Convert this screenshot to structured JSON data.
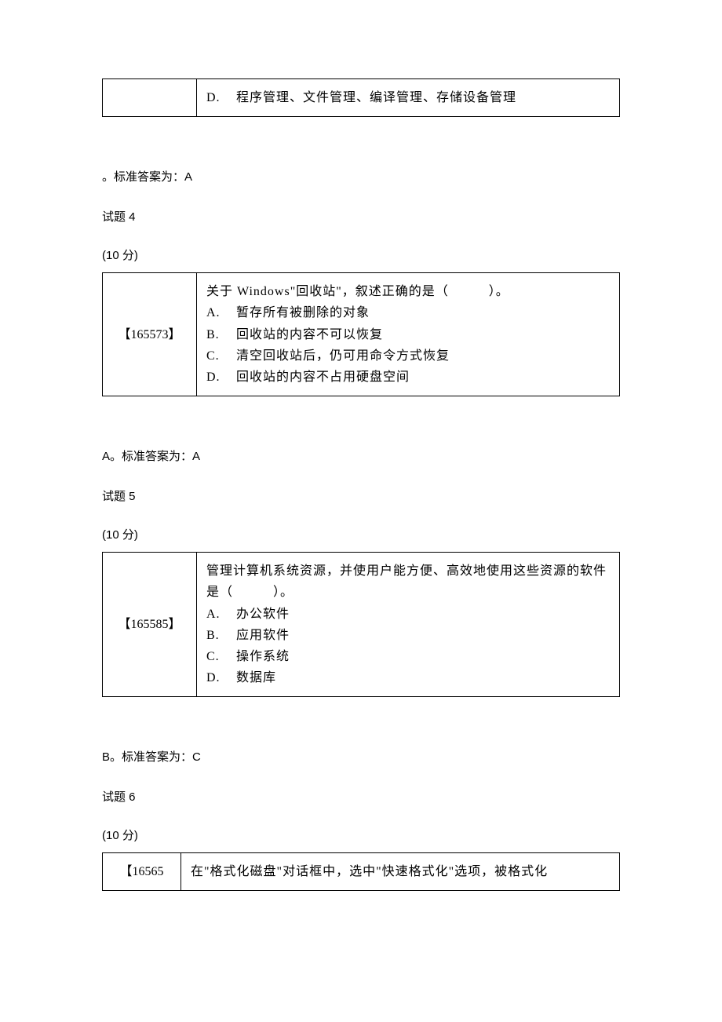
{
  "q3": {
    "optD_label": "D.",
    "optD": "程序管理、文件管理、编译管理、存储设备管理",
    "answer": "。标准答案为：A"
  },
  "q4": {
    "label": "试题 4",
    "points": "(10 分)",
    "id": "【165573】",
    "stem": "关于 Windows\"回收站\"，叙述正确的是（　　　）。",
    "optA_label": "A.",
    "optA": "暂存所有被删除的对象",
    "optB_label": "B.",
    "optB": "回收站的内容不可以恢复",
    "optC_label": "C.",
    "optC": "清空回收站后，仍可用命令方式恢复",
    "optD_label": "D.",
    "optD": "回收站的内容不占用硬盘空间",
    "answer": "A。标准答案为：A"
  },
  "q5": {
    "label": "试题 5",
    "points": "(10 分)",
    "id": "【165585】",
    "stem": "管理计算机系统资源，并使用户能方便、高效地使用这些资源的软件是（　　　）。",
    "optA_label": "A.",
    "optA": "办公软件",
    "optB_label": "B.",
    "optB": "应用软件",
    "optC_label": "C.",
    "optC": "操作系统",
    "optD_label": "D.",
    "optD": "数据库",
    "answer": "B。标准答案为：C"
  },
  "q6": {
    "label": "试题 6",
    "points": "(10 分)",
    "id": "【16565",
    "stem": "在\"格式化磁盘\"对话框中，选中\"快速格式化\"选项，被格式化"
  }
}
